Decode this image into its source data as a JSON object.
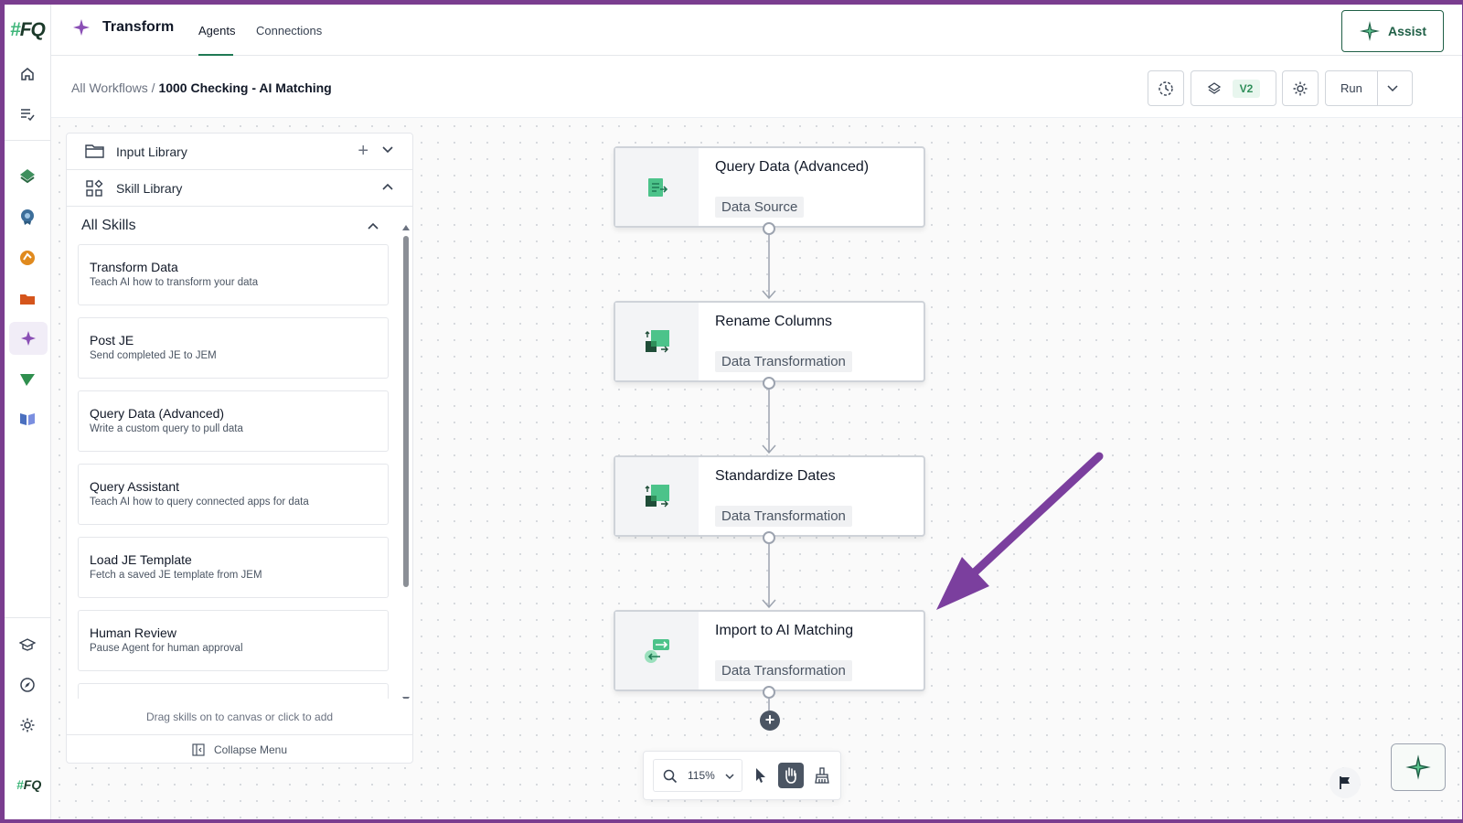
{
  "app": {
    "title": "Transform",
    "tabs": [
      {
        "label": "Agents",
        "active": true
      },
      {
        "label": "Connections",
        "active": false
      }
    ],
    "assist_label": "Assist",
    "logo_text": "FQ",
    "logo_hash": "#"
  },
  "breadcrumb": {
    "parent": "All Workflows",
    "separator": "/",
    "current": "1000 Checking - AI Matching"
  },
  "toolbar": {
    "version_label": "V2",
    "run_label": "Run"
  },
  "panel": {
    "input_library_label": "Input Library",
    "skill_library_label": "Skill Library",
    "all_skills_label": "All Skills",
    "skills": [
      {
        "title": "Transform Data",
        "desc": "Teach AI how to transform your data"
      },
      {
        "title": "Post JE",
        "desc": "Send completed JE to JEM"
      },
      {
        "title": "Query Data (Advanced)",
        "desc": "Write a custom query to pull data"
      },
      {
        "title": "Query Assistant",
        "desc": "Teach AI how to query connected apps for data"
      },
      {
        "title": "Load JE Template",
        "desc": "Fetch a saved JE template from JEM"
      },
      {
        "title": "Human Review",
        "desc": "Pause Agent for human approval"
      }
    ],
    "drag_hint": "Drag skills on to canvas or click to add",
    "collapse_label": "Collapse Menu"
  },
  "workflow": {
    "nodes": [
      {
        "title": "Query Data (Advanced)",
        "tag": "Data Source",
        "icon": "document-icon"
      },
      {
        "title": "Rename Columns",
        "tag": "Data Transformation",
        "icon": "table-transform-icon"
      },
      {
        "title": "Standardize Dates",
        "tag": "Data Transformation",
        "icon": "table-transform-icon"
      },
      {
        "title": "Import to AI Matching",
        "tag": "Data Transformation",
        "icon": "swap-arrows-icon"
      }
    ]
  },
  "canvas_toolbar": {
    "zoom": "115%"
  },
  "colors": {
    "brand_green": "#1f5f46",
    "accent_purple": "#7a3d8f",
    "node_border": "#cfd3d9"
  }
}
